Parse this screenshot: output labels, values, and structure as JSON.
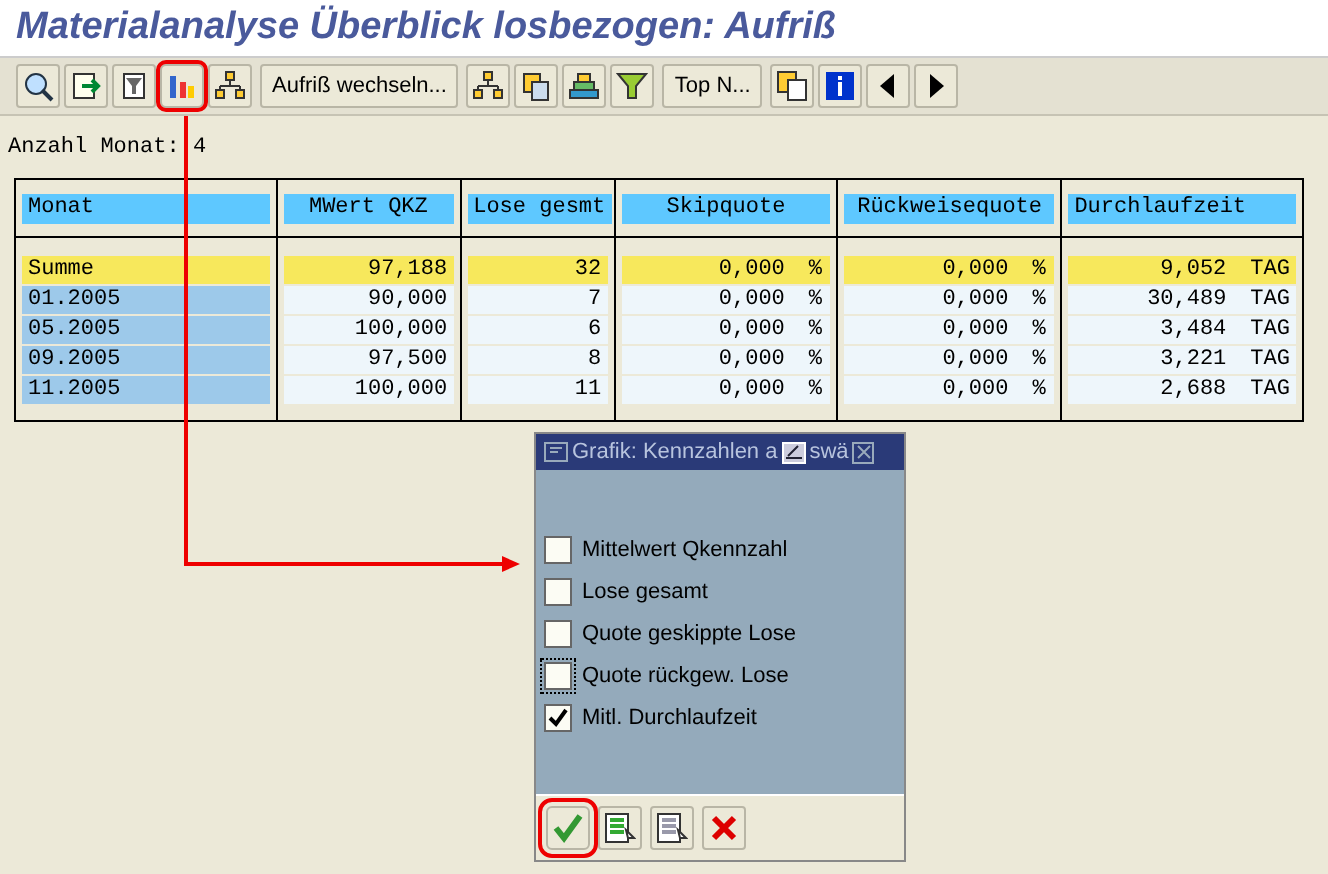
{
  "window": {
    "title": "Materialanalyse Überblick losbezogen: Aufriß"
  },
  "toolbar": [
    {
      "kind": "icon",
      "highlighted": false
    },
    {
      "kind": "icon",
      "highlighted": false
    },
    {
      "kind": "icon",
      "highlighted": false
    },
    {
      "kind": "icon",
      "highlighted": true
    },
    {
      "kind": "icon",
      "highlighted": false
    },
    {
      "kind": "text",
      "label": "Aufriß wechseln...",
      "highlighted": false
    },
    {
      "kind": "icon",
      "highlighted": false
    },
    {
      "kind": "icon",
      "highlighted": false
    },
    {
      "kind": "icon",
      "highlighted": false
    },
    {
      "kind": "icon",
      "highlighted": false
    },
    {
      "kind": "text",
      "label": "Top N...",
      "highlighted": false
    },
    {
      "kind": "icon",
      "highlighted": false
    },
    {
      "kind": "icon",
      "highlighted": false
    },
    {
      "kind": "icon",
      "highlighted": false
    },
    {
      "kind": "icon",
      "highlighted": false
    }
  ],
  "summary": {
    "label": "Anzahl Monat:",
    "value": "4"
  },
  "table": {
    "columns": [
      {
        "label": "Monat"
      },
      {
        "label": "MWert QKZ"
      },
      {
        "label": "Lose gesmt"
      },
      {
        "label": "Skipquote"
      },
      {
        "label": "Rückweisequote"
      },
      {
        "label": "Durchlaufzeit"
      }
    ],
    "rows": [
      {
        "kind": "total",
        "cells": [
          {
            "text": "Summe"
          },
          {
            "text": "97,188"
          },
          {
            "text": "32"
          },
          {
            "text": "0,000",
            "unit": "%"
          },
          {
            "text": "0,000",
            "unit": "%"
          },
          {
            "text": "9,052",
            "unit": "TAG"
          }
        ]
      },
      {
        "kind": "data",
        "cells": [
          {
            "text": "01.2005"
          },
          {
            "text": "90,000"
          },
          {
            "text": "7"
          },
          {
            "text": "0,000",
            "unit": "%"
          },
          {
            "text": "0,000",
            "unit": "%"
          },
          {
            "text": "30,489",
            "unit": "TAG"
          }
        ]
      },
      {
        "kind": "data",
        "cells": [
          {
            "text": "05.2005"
          },
          {
            "text": "100,000"
          },
          {
            "text": "6"
          },
          {
            "text": "0,000",
            "unit": "%"
          },
          {
            "text": "0,000",
            "unit": "%"
          },
          {
            "text": "3,484",
            "unit": "TAG"
          }
        ]
      },
      {
        "kind": "data",
        "cells": [
          {
            "text": "09.2005"
          },
          {
            "text": "97,500"
          },
          {
            "text": "8"
          },
          {
            "text": "0,000",
            "unit": "%"
          },
          {
            "text": "0,000",
            "unit": "%"
          },
          {
            "text": "3,221",
            "unit": "TAG"
          }
        ]
      },
      {
        "kind": "data",
        "cells": [
          {
            "text": "11.2005"
          },
          {
            "text": "100,000"
          },
          {
            "text": "11"
          },
          {
            "text": "0,000",
            "unit": "%"
          },
          {
            "text": "0,000",
            "unit": "%"
          },
          {
            "text": "2,688",
            "unit": "TAG"
          }
        ]
      }
    ]
  },
  "dialog": {
    "title_start": "Grafik: Kennzahlen a",
    "title_end": "swä",
    "options": [
      {
        "label": "Mittelwert Qkennzahl",
        "checked": false,
        "focused": false
      },
      {
        "label": "Lose gesamt",
        "checked": false,
        "focused": false
      },
      {
        "label": "Quote geskippte Lose",
        "checked": false,
        "focused": false
      },
      {
        "label": "Quote rückgew. Lose",
        "checked": false,
        "focused": true
      },
      {
        "label": "Mitl. Durchlaufzeit",
        "checked": true,
        "focused": false
      }
    ],
    "buttons": [
      {
        "kind": "confirm",
        "highlighted": true
      },
      {
        "kind": "select-all",
        "highlighted": false
      },
      {
        "kind": "deselect-all",
        "highlighted": false
      },
      {
        "kind": "cancel",
        "highlighted": false
      }
    ]
  }
}
